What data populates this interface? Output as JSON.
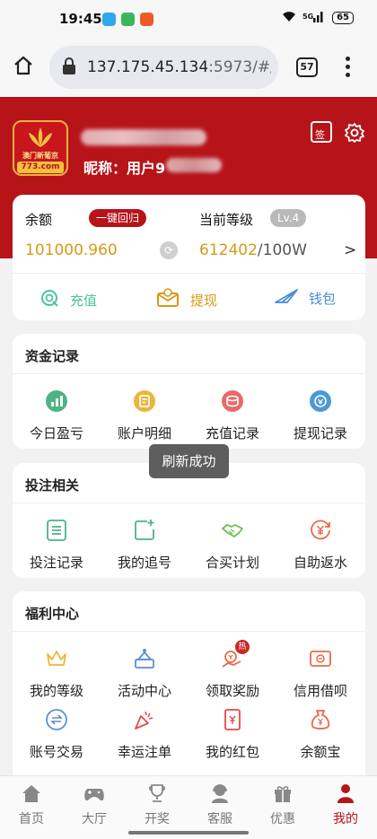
{
  "status_bar": {
    "time": "19:45",
    "battery": "65"
  },
  "browser": {
    "url_host": "137.175.45.134",
    "url_rest": ":5973/#/",
    "tab_count": "57"
  },
  "header": {
    "logo_text": "澳门新葡京",
    "logo_domain": "773.com",
    "nickname_label": "昵称：用户9",
    "sign_label": "签"
  },
  "balance_card": {
    "balance_label": "余额",
    "recall_button": "一键回归",
    "balance_value": "101000.960",
    "level_label": "当前等级",
    "level_badge": "Lv.4",
    "level_points": "612402",
    "level_goal": "/100W",
    "level_arrow": ">",
    "actions": [
      {
        "label": "充值",
        "color": "#4cc49a"
      },
      {
        "label": "提现",
        "color": "#d59a17"
      },
      {
        "label": "钱包",
        "color": "#4a8fd6"
      }
    ]
  },
  "funds": {
    "title": "资金记录",
    "items": [
      {
        "label": "今日盈亏",
        "icon": "chart-icon",
        "color": "#4cb483"
      },
      {
        "label": "账户明细",
        "icon": "receipt-icon",
        "color": "#f0b43a"
      },
      {
        "label": "充值记录",
        "icon": "coins-icon",
        "color": "#e86a6a"
      },
      {
        "label": "提现记录",
        "icon": "coin-out-icon",
        "color": "#4a9ad6"
      }
    ]
  },
  "bets": {
    "title": "投注相关",
    "items": [
      {
        "label": "投注记录",
        "icon": "list-icon",
        "color": "#4cb483"
      },
      {
        "label": "我的追号",
        "icon": "add-doc-icon",
        "color": "#4cb483"
      },
      {
        "label": "合买计划",
        "icon": "handshake-icon",
        "color": "#6bbf55"
      },
      {
        "label": "自助返水",
        "icon": "yen-return-icon",
        "color": "#e86a4a"
      }
    ]
  },
  "welfare": {
    "title": "福利中心",
    "items": [
      {
        "label": "我的等级",
        "icon": "crown-icon",
        "color": "#f0b43a"
      },
      {
        "label": "活动中心",
        "icon": "gift-icon",
        "color": "#5a8fd6"
      },
      {
        "label": "领取奖励",
        "icon": "reward-icon",
        "color": "#e86a4a",
        "badge": "热"
      },
      {
        "label": "信用借呗",
        "icon": "card-icon",
        "color": "#e86a4a"
      },
      {
        "label": "账号交易",
        "icon": "exchange-icon",
        "color": "#5a8fd6"
      },
      {
        "label": "幸运注单",
        "icon": "party-icon",
        "color": "#e84a4a"
      },
      {
        "label": "我的红包",
        "icon": "red-envelope-icon",
        "color": "#e84a4a"
      },
      {
        "label": "余额宝",
        "icon": "money-bag-icon",
        "color": "#e86a4a"
      }
    ]
  },
  "toast": "刷新成功",
  "tabbar": [
    {
      "label": "首页",
      "icon": "home-icon"
    },
    {
      "label": "大厅",
      "icon": "gamepad-icon"
    },
    {
      "label": "开奖",
      "icon": "trophy-icon"
    },
    {
      "label": "客服",
      "icon": "support-icon"
    },
    {
      "label": "优惠",
      "icon": "gift-box-icon"
    },
    {
      "label": "我的",
      "icon": "user-icon",
      "active": true
    }
  ]
}
